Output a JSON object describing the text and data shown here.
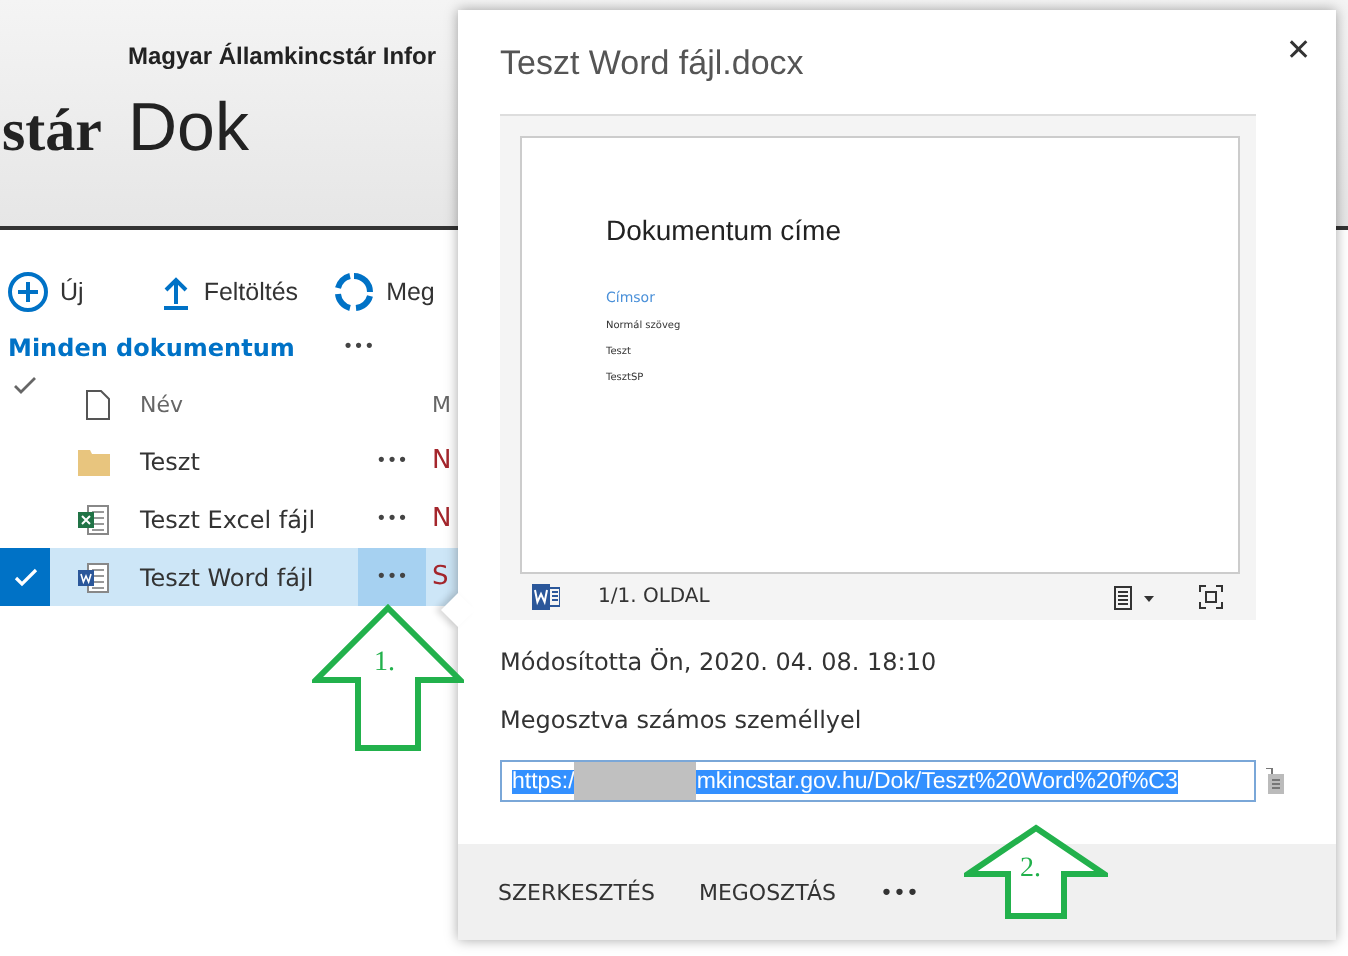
{
  "header": {
    "site_title": "Magyar Államkincstár Infor",
    "logo_text": "stár",
    "page_title": "Dok"
  },
  "toolbar": [
    {
      "kind": "new",
      "label": "Új"
    },
    {
      "kind": "upload",
      "label": "Feltöltés"
    },
    {
      "kind": "sync",
      "label": "Meg"
    }
  ],
  "view": {
    "label": "Minden dokumentum",
    "more": "•••"
  },
  "table": {
    "columns": [
      {
        "label": "Név"
      },
      {
        "label": "M"
      }
    ],
    "rows": [
      {
        "kind": "folder",
        "name": "Teszt",
        "more": "•••",
        "column_5": "N",
        "selected": false
      },
      {
        "kind": "excel",
        "name": "Teszt Excel fájl",
        "more": "•••",
        "column_5": "N",
        "selected": false
      },
      {
        "kind": "word",
        "name": "Teszt Word fájl",
        "more": "•••",
        "column_5": "S",
        "selected": true
      }
    ]
  },
  "callout": {
    "title": "Teszt Word fájl.docx",
    "close": "✕",
    "preview": {
      "heading": "Dokumentum címe",
      "subheading": "Címsor",
      "lines": [
        "Normál szöveg",
        "Teszt",
        "TesztSP"
      ],
      "page": "1/1. OLDAL"
    },
    "modified": "Módosította Ön, 2020. 04. 08. 18:10",
    "shared": "Megosztva számos személlyel",
    "url": {
      "prefix": "https:/",
      "suffix": "mkincstar.gov.hu/Dok/Teszt%20Word%20f%C3",
      "selected": true
    },
    "actions": [
      {
        "label": "SZERKESZTÉS"
      },
      {
        "label": "MEGOSZTÁS"
      }
    ],
    "more": "•••"
  },
  "annotations": [
    {
      "label": "1."
    },
    {
      "label": "2."
    }
  ]
}
